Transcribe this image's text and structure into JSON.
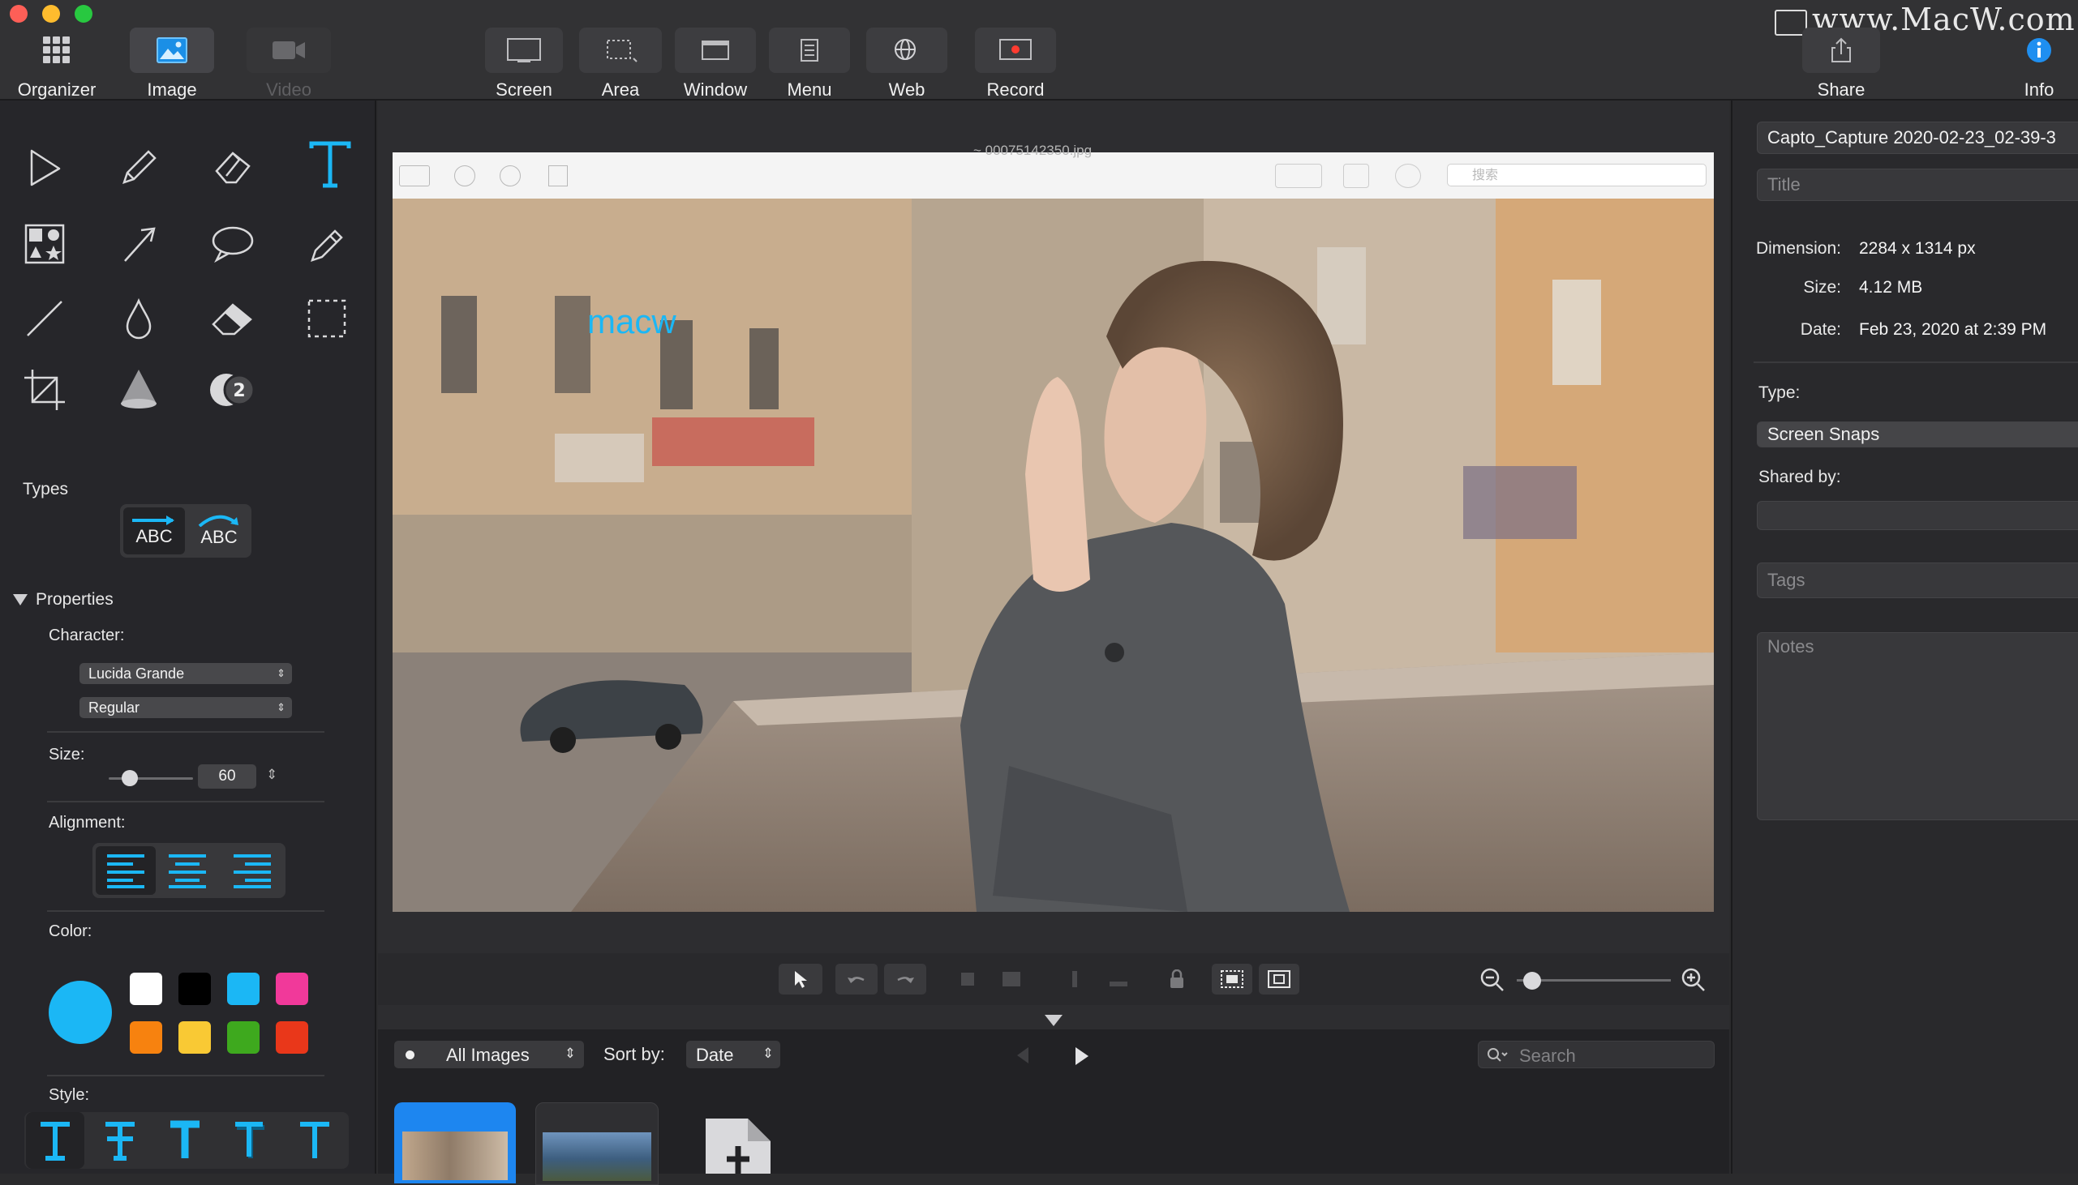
{
  "watermark": "www.MacW.com",
  "toolbar": {
    "left": [
      {
        "id": "organizer",
        "label": "Organizer",
        "icon": "grid-icon"
      },
      {
        "id": "image",
        "label": "Image",
        "icon": "image-icon"
      },
      {
        "id": "video",
        "label": "Video",
        "icon": "video-camera-icon"
      }
    ],
    "capture": [
      {
        "id": "screen",
        "label": "Screen",
        "icon": "screen-capture-icon"
      },
      {
        "id": "area",
        "label": "Area",
        "icon": "area-capture-icon"
      },
      {
        "id": "window",
        "label": "Window",
        "icon": "window-capture-icon"
      },
      {
        "id": "menu",
        "label": "Menu",
        "icon": "menu-capture-icon"
      },
      {
        "id": "web",
        "label": "Web",
        "icon": "globe-icon"
      },
      {
        "id": "record",
        "label": "Record",
        "icon": "record-icon"
      }
    ],
    "share_label": "Share",
    "info_label": "Info"
  },
  "tools": {
    "types_label": "Types",
    "type_options": [
      "ABC",
      "ABC"
    ],
    "properties_label": "Properties",
    "character_label": "Character:",
    "font_family": "Lucida Grande",
    "font_style": "Regular",
    "size_label": "Size:",
    "size_value": "60",
    "size_slider_fraction": 0.25,
    "alignment_label": "Alignment:",
    "color_label": "Color:",
    "selected_color": "#1bb7f5",
    "colors": [
      "#ffffff",
      "#000000",
      "#1bb7f5",
      "#f1399a",
      "#f7820f",
      "#f9c934",
      "#3ea91e",
      "#e9371a"
    ],
    "style_label": "Style:"
  },
  "canvas": {
    "annotation_text": "macw",
    "inner_search_placeholder": "搜索",
    "inner_title": "~ 00075142350.jpg"
  },
  "browser": {
    "filter": "All Images",
    "sort_label": "Sort by:",
    "sort_value": "Date",
    "search_placeholder": "Search",
    "zoom_fraction": 0.1
  },
  "info": {
    "filename": "Capto_Capture 2020-02-23_02-39-3",
    "title_placeholder": "Title",
    "dimension_label": "Dimension:",
    "dimension_value": "2284 x 1314 px",
    "size_label": "Size:",
    "size_value": "4.12 MB",
    "date_label": "Date:",
    "date_value": "Feb 23, 2020 at 2:39 PM",
    "type_label": "Type:",
    "type_value": "Screen Snaps",
    "shared_label": "Shared by:",
    "tags_placeholder": "Tags",
    "notes_placeholder": "Notes"
  }
}
